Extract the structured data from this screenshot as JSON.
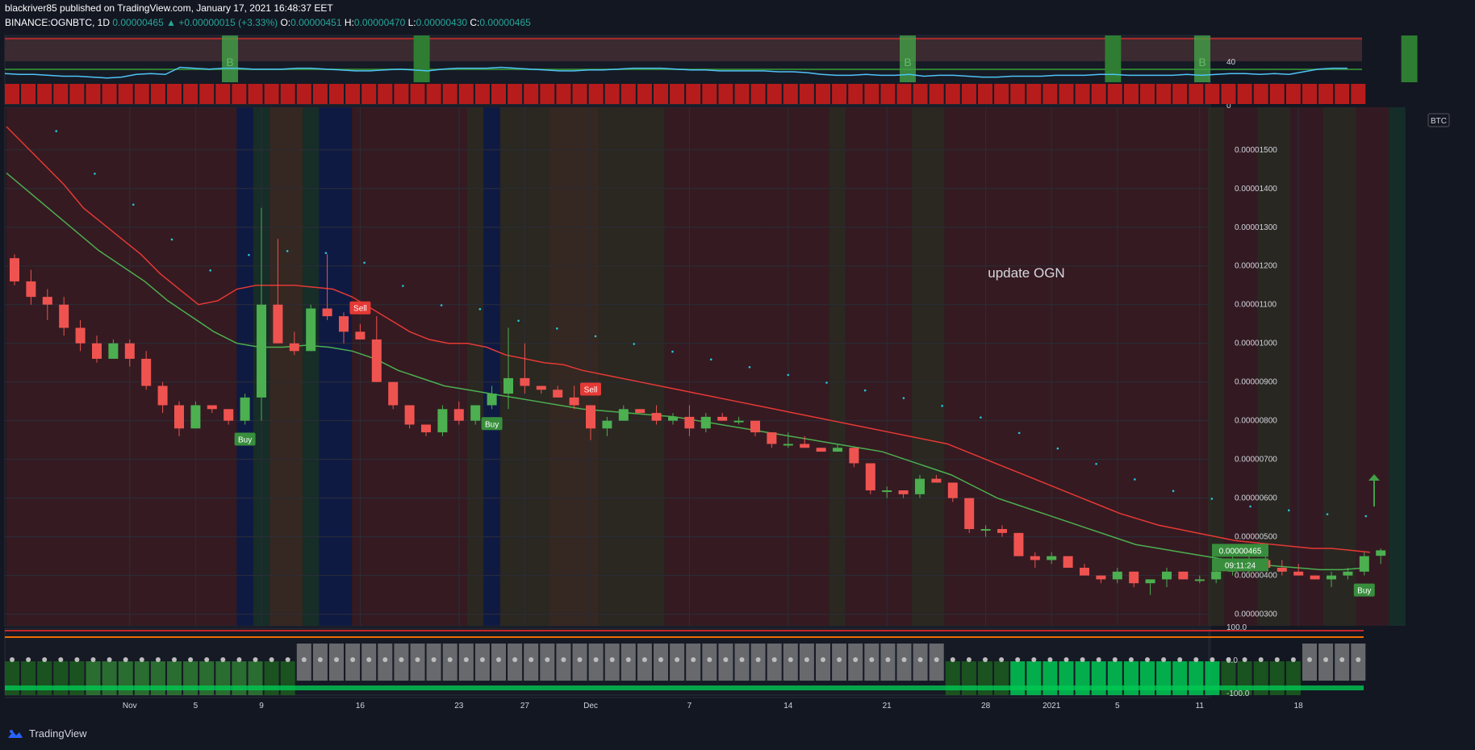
{
  "header": {
    "publisher_line": "blackriver85 published on TradingView.com, January 17, 2021 16:48:37 EET",
    "symbol": "BINANCE:OGNBTC, 1D",
    "last": "0.00000465",
    "change": "+0.00000015 (+3.33%)",
    "o_label": "O:",
    "o": "0.00000451",
    "h_label": "H:",
    "h": "0.00000470",
    "l_label": "L:",
    "l": "0.00000430",
    "c_label": "C:",
    "c": "0.00000465"
  },
  "brand": {
    "name": "TradingView"
  },
  "annotation": "update OGN",
  "currency_badge": "BTC",
  "price_label": "0.00000465",
  "countdown_label": "09:11:24",
  "colors": {
    "bg": "#131722",
    "up": "#4caf50",
    "down": "#ef5350",
    "ema_red": "#e53935",
    "ema_green": "#4caf50",
    "dots": "#26c6da",
    "grid": "#2a2e39",
    "osc": "#4fc3f7"
  },
  "chart_data": [
    {
      "type": "line",
      "title": "Top oscillator",
      "y_ticks": [
        "40",
        "0"
      ],
      "highlight_label": "B",
      "values": [
        38,
        37,
        37,
        36,
        35,
        35,
        34,
        33,
        34,
        37,
        38,
        37,
        45,
        44,
        43,
        44,
        44,
        43,
        43,
        43,
        44,
        44,
        43,
        42,
        41,
        41,
        42,
        43,
        42,
        41,
        43,
        44,
        44,
        44,
        45,
        44,
        43,
        42,
        41,
        41,
        42,
        42,
        43,
        44,
        44,
        44,
        43,
        42,
        42,
        41,
        41,
        41,
        41,
        40,
        40,
        39,
        37,
        36,
        36,
        37,
        36,
        36,
        37,
        35,
        36,
        36,
        35,
        34,
        34,
        35,
        35,
        35,
        36,
        36,
        36,
        37,
        37,
        36,
        36,
        36,
        36,
        37,
        36,
        37,
        38,
        38,
        37,
        38,
        37,
        40,
        43,
        44,
        44
      ]
    },
    {
      "type": "candlestick",
      "title": "BINANCE:OGNBTC, 1D",
      "x_ticks": [
        "Nov",
        "5",
        "9",
        "16",
        "23",
        "27",
        "Dec",
        "7",
        "14",
        "21",
        "28",
        "2021",
        "5",
        "11",
        "18"
      ],
      "y_ticks": [
        "0.00001500",
        "0.00001400",
        "0.00001300",
        "0.00001200",
        "0.00001100",
        "0.00001000",
        "0.00000900",
        "0.00000800",
        "0.00000700",
        "0.00000600",
        "0.00000500",
        "0.00000400",
        "0.00000300"
      ],
      "ohlc": [
        [
          1220,
          1230,
          1150,
          1160
        ],
        [
          1160,
          1190,
          1100,
          1120
        ],
        [
          1120,
          1140,
          1060,
          1100
        ],
        [
          1100,
          1120,
          1020,
          1040
        ],
        [
          1040,
          1060,
          980,
          1000
        ],
        [
          1000,
          1020,
          950,
          960
        ],
        [
          960,
          1010,
          960,
          1000
        ],
        [
          1000,
          1010,
          940,
          960
        ],
        [
          960,
          980,
          880,
          890
        ],
        [
          890,
          900,
          820,
          840
        ],
        [
          840,
          850,
          760,
          780
        ],
        [
          780,
          850,
          780,
          840
        ],
        [
          840,
          840,
          820,
          830
        ],
        [
          830,
          830,
          790,
          800
        ],
        [
          800,
          870,
          790,
          860
        ],
        [
          860,
          1350,
          800,
          1100
        ],
        [
          1100,
          1270,
          1000,
          1000
        ],
        [
          1000,
          1030,
          970,
          980
        ],
        [
          980,
          1100,
          980,
          1090
        ],
        [
          1090,
          1230,
          1060,
          1070
        ],
        [
          1070,
          1080,
          1000,
          1030
        ],
        [
          1030,
          1050,
          1010,
          1010
        ],
        [
          1010,
          1070,
          900,
          900
        ],
        [
          900,
          900,
          830,
          840
        ],
        [
          840,
          840,
          780,
          790
        ],
        [
          790,
          790,
          760,
          770
        ],
        [
          770,
          840,
          760,
          830
        ],
        [
          830,
          850,
          790,
          800
        ],
        [
          800,
          840,
          790,
          840
        ],
        [
          840,
          890,
          830,
          870
        ],
        [
          870,
          1040,
          830,
          910
        ],
        [
          910,
          1000,
          870,
          890
        ],
        [
          890,
          880,
          870,
          880
        ],
        [
          880,
          890,
          860,
          860
        ],
        [
          860,
          890,
          830,
          840
        ],
        [
          840,
          840,
          750,
          780
        ],
        [
          780,
          810,
          760,
          800
        ],
        [
          800,
          840,
          800,
          830
        ],
        [
          830,
          830,
          820,
          820
        ],
        [
          820,
          840,
          790,
          800
        ],
        [
          800,
          820,
          790,
          810
        ],
        [
          810,
          840,
          760,
          780
        ],
        [
          780,
          820,
          770,
          810
        ],
        [
          810,
          820,
          800,
          800
        ],
        [
          800,
          810,
          790,
          800
        ],
        [
          800,
          800,
          760,
          770
        ],
        [
          770,
          770,
          730,
          740
        ],
        [
          740,
          770,
          730,
          740
        ],
        [
          740,
          760,
          730,
          730
        ],
        [
          730,
          730,
          720,
          720
        ],
        [
          720,
          740,
          720,
          730
        ],
        [
          730,
          730,
          680,
          690
        ],
        [
          690,
          690,
          610,
          620
        ],
        [
          620,
          630,
          600,
          620
        ],
        [
          620,
          620,
          600,
          610
        ],
        [
          610,
          660,
          600,
          650
        ],
        [
          650,
          660,
          640,
          640
        ],
        [
          640,
          640,
          590,
          600
        ],
        [
          600,
          600,
          510,
          520
        ],
        [
          520,
          530,
          500,
          520
        ],
        [
          520,
          530,
          500,
          510
        ],
        [
          510,
          510,
          450,
          450
        ],
        [
          450,
          460,
          420,
          440
        ],
        [
          440,
          460,
          430,
          450
        ],
        [
          450,
          450,
          420,
          420
        ],
        [
          420,
          430,
          400,
          400
        ],
        [
          400,
          400,
          380,
          390
        ],
        [
          390,
          420,
          380,
          410
        ],
        [
          410,
          410,
          370,
          380
        ],
        [
          380,
          380,
          350,
          390
        ],
        [
          390,
          420,
          370,
          410
        ],
        [
          410,
          410,
          390,
          390
        ],
        [
          390,
          400,
          380,
          390
        ],
        [
          390,
          420,
          380,
          410
        ],
        [
          410,
          470,
          400,
          420
        ],
        [
          420,
          450,
          400,
          440
        ],
        [
          440,
          450,
          420,
          420
        ],
        [
          420,
          440,
          400,
          410
        ],
        [
          410,
          430,
          400,
          400
        ],
        [
          400,
          400,
          390,
          390
        ],
        [
          390,
          410,
          370,
          400
        ],
        [
          400,
          420,
          390,
          410
        ],
        [
          410,
          460,
          400,
          450
        ],
        [
          451,
          470,
          430,
          465
        ]
      ],
      "ema_red": [
        1560,
        1510,
        1460,
        1410,
        1350,
        1310,
        1270,
        1230,
        1180,
        1140,
        1100,
        1110,
        1140,
        1150,
        1150,
        1150,
        1145,
        1140,
        1120,
        1090,
        1060,
        1030,
        1010,
        1000,
        1000,
        990,
        970,
        960,
        950,
        945,
        930,
        920,
        910,
        900,
        890,
        880,
        870,
        860,
        850,
        840,
        830,
        820,
        810,
        800,
        790,
        780,
        770,
        760,
        750,
        740,
        720,
        700,
        680,
        660,
        640,
        620,
        600,
        580,
        560,
        545,
        530,
        520,
        510,
        500,
        490,
        485,
        480,
        475,
        470,
        470,
        465,
        460
      ],
      "ema_green": [
        1440,
        1390,
        1340,
        1290,
        1240,
        1200,
        1160,
        1110,
        1070,
        1030,
        1000,
        990,
        990,
        995,
        990,
        980,
        960,
        930,
        910,
        890,
        880,
        870,
        860,
        850,
        840,
        830,
        825,
        820,
        815,
        810,
        800,
        790,
        780,
        770,
        760,
        750,
        740,
        730,
        720,
        700,
        680,
        660,
        630,
        600,
        580,
        560,
        540,
        520,
        500,
        480,
        470,
        460,
        450,
        440,
        430,
        425,
        420,
        415,
        415,
        420
      ],
      "signals": [
        {
          "label": "Buy",
          "i": 14
        },
        {
          "label": "Sell",
          "i": 21
        },
        {
          "label": "Buy",
          "i": 29
        },
        {
          "label": "Sell",
          "i": 35
        },
        {
          "label": "Buy",
          "i": 82
        }
      ]
    },
    {
      "type": "bar",
      "title": "Bottom oscillator",
      "y_ticks": [
        "100.0",
        "0.0",
        "-100.0"
      ]
    }
  ]
}
